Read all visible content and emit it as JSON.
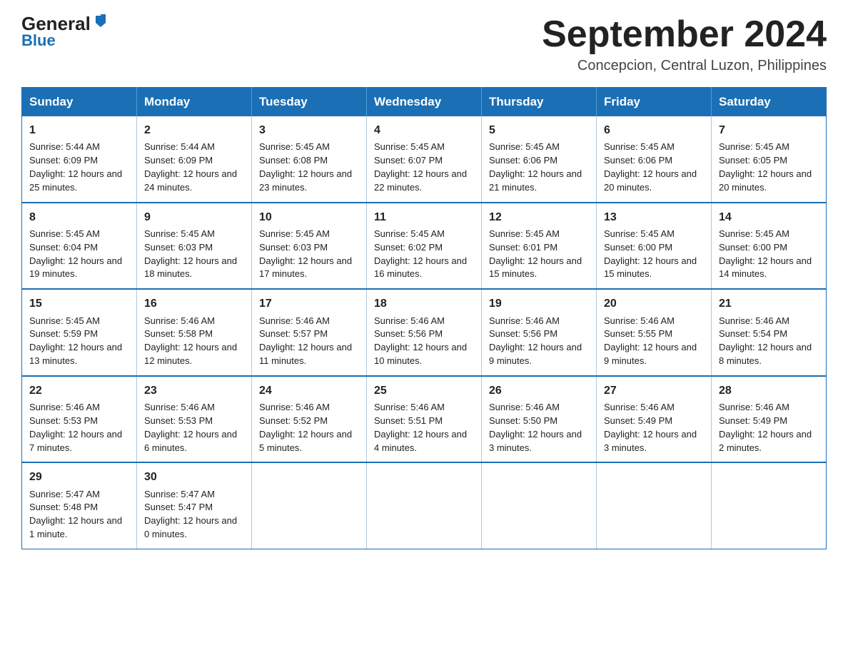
{
  "header": {
    "logo_top": "General",
    "logo_arrow": "▶",
    "logo_bottom": "Blue",
    "month_title": "September 2024",
    "location": "Concepcion, Central Luzon, Philippines"
  },
  "days_of_week": [
    "Sunday",
    "Monday",
    "Tuesday",
    "Wednesday",
    "Thursday",
    "Friday",
    "Saturday"
  ],
  "weeks": [
    [
      {
        "day": "1",
        "sunrise": "5:44 AM",
        "sunset": "6:09 PM",
        "daylight": "12 hours and 25 minutes."
      },
      {
        "day": "2",
        "sunrise": "5:44 AM",
        "sunset": "6:09 PM",
        "daylight": "12 hours and 24 minutes."
      },
      {
        "day": "3",
        "sunrise": "5:45 AM",
        "sunset": "6:08 PM",
        "daylight": "12 hours and 23 minutes."
      },
      {
        "day": "4",
        "sunrise": "5:45 AM",
        "sunset": "6:07 PM",
        "daylight": "12 hours and 22 minutes."
      },
      {
        "day": "5",
        "sunrise": "5:45 AM",
        "sunset": "6:06 PM",
        "daylight": "12 hours and 21 minutes."
      },
      {
        "day": "6",
        "sunrise": "5:45 AM",
        "sunset": "6:06 PM",
        "daylight": "12 hours and 20 minutes."
      },
      {
        "day": "7",
        "sunrise": "5:45 AM",
        "sunset": "6:05 PM",
        "daylight": "12 hours and 20 minutes."
      }
    ],
    [
      {
        "day": "8",
        "sunrise": "5:45 AM",
        "sunset": "6:04 PM",
        "daylight": "12 hours and 19 minutes."
      },
      {
        "day": "9",
        "sunrise": "5:45 AM",
        "sunset": "6:03 PM",
        "daylight": "12 hours and 18 minutes."
      },
      {
        "day": "10",
        "sunrise": "5:45 AM",
        "sunset": "6:03 PM",
        "daylight": "12 hours and 17 minutes."
      },
      {
        "day": "11",
        "sunrise": "5:45 AM",
        "sunset": "6:02 PM",
        "daylight": "12 hours and 16 minutes."
      },
      {
        "day": "12",
        "sunrise": "5:45 AM",
        "sunset": "6:01 PM",
        "daylight": "12 hours and 15 minutes."
      },
      {
        "day": "13",
        "sunrise": "5:45 AM",
        "sunset": "6:00 PM",
        "daylight": "12 hours and 15 minutes."
      },
      {
        "day": "14",
        "sunrise": "5:45 AM",
        "sunset": "6:00 PM",
        "daylight": "12 hours and 14 minutes."
      }
    ],
    [
      {
        "day": "15",
        "sunrise": "5:45 AM",
        "sunset": "5:59 PM",
        "daylight": "12 hours and 13 minutes."
      },
      {
        "day": "16",
        "sunrise": "5:46 AM",
        "sunset": "5:58 PM",
        "daylight": "12 hours and 12 minutes."
      },
      {
        "day": "17",
        "sunrise": "5:46 AM",
        "sunset": "5:57 PM",
        "daylight": "12 hours and 11 minutes."
      },
      {
        "day": "18",
        "sunrise": "5:46 AM",
        "sunset": "5:56 PM",
        "daylight": "12 hours and 10 minutes."
      },
      {
        "day": "19",
        "sunrise": "5:46 AM",
        "sunset": "5:56 PM",
        "daylight": "12 hours and 9 minutes."
      },
      {
        "day": "20",
        "sunrise": "5:46 AM",
        "sunset": "5:55 PM",
        "daylight": "12 hours and 9 minutes."
      },
      {
        "day": "21",
        "sunrise": "5:46 AM",
        "sunset": "5:54 PM",
        "daylight": "12 hours and 8 minutes."
      }
    ],
    [
      {
        "day": "22",
        "sunrise": "5:46 AM",
        "sunset": "5:53 PM",
        "daylight": "12 hours and 7 minutes."
      },
      {
        "day": "23",
        "sunrise": "5:46 AM",
        "sunset": "5:53 PM",
        "daylight": "12 hours and 6 minutes."
      },
      {
        "day": "24",
        "sunrise": "5:46 AM",
        "sunset": "5:52 PM",
        "daylight": "12 hours and 5 minutes."
      },
      {
        "day": "25",
        "sunrise": "5:46 AM",
        "sunset": "5:51 PM",
        "daylight": "12 hours and 4 minutes."
      },
      {
        "day": "26",
        "sunrise": "5:46 AM",
        "sunset": "5:50 PM",
        "daylight": "12 hours and 3 minutes."
      },
      {
        "day": "27",
        "sunrise": "5:46 AM",
        "sunset": "5:49 PM",
        "daylight": "12 hours and 3 minutes."
      },
      {
        "day": "28",
        "sunrise": "5:46 AM",
        "sunset": "5:49 PM",
        "daylight": "12 hours and 2 minutes."
      }
    ],
    [
      {
        "day": "29",
        "sunrise": "5:47 AM",
        "sunset": "5:48 PM",
        "daylight": "12 hours and 1 minute."
      },
      {
        "day": "30",
        "sunrise": "5:47 AM",
        "sunset": "5:47 PM",
        "daylight": "12 hours and 0 minutes."
      },
      null,
      null,
      null,
      null,
      null
    ]
  ]
}
